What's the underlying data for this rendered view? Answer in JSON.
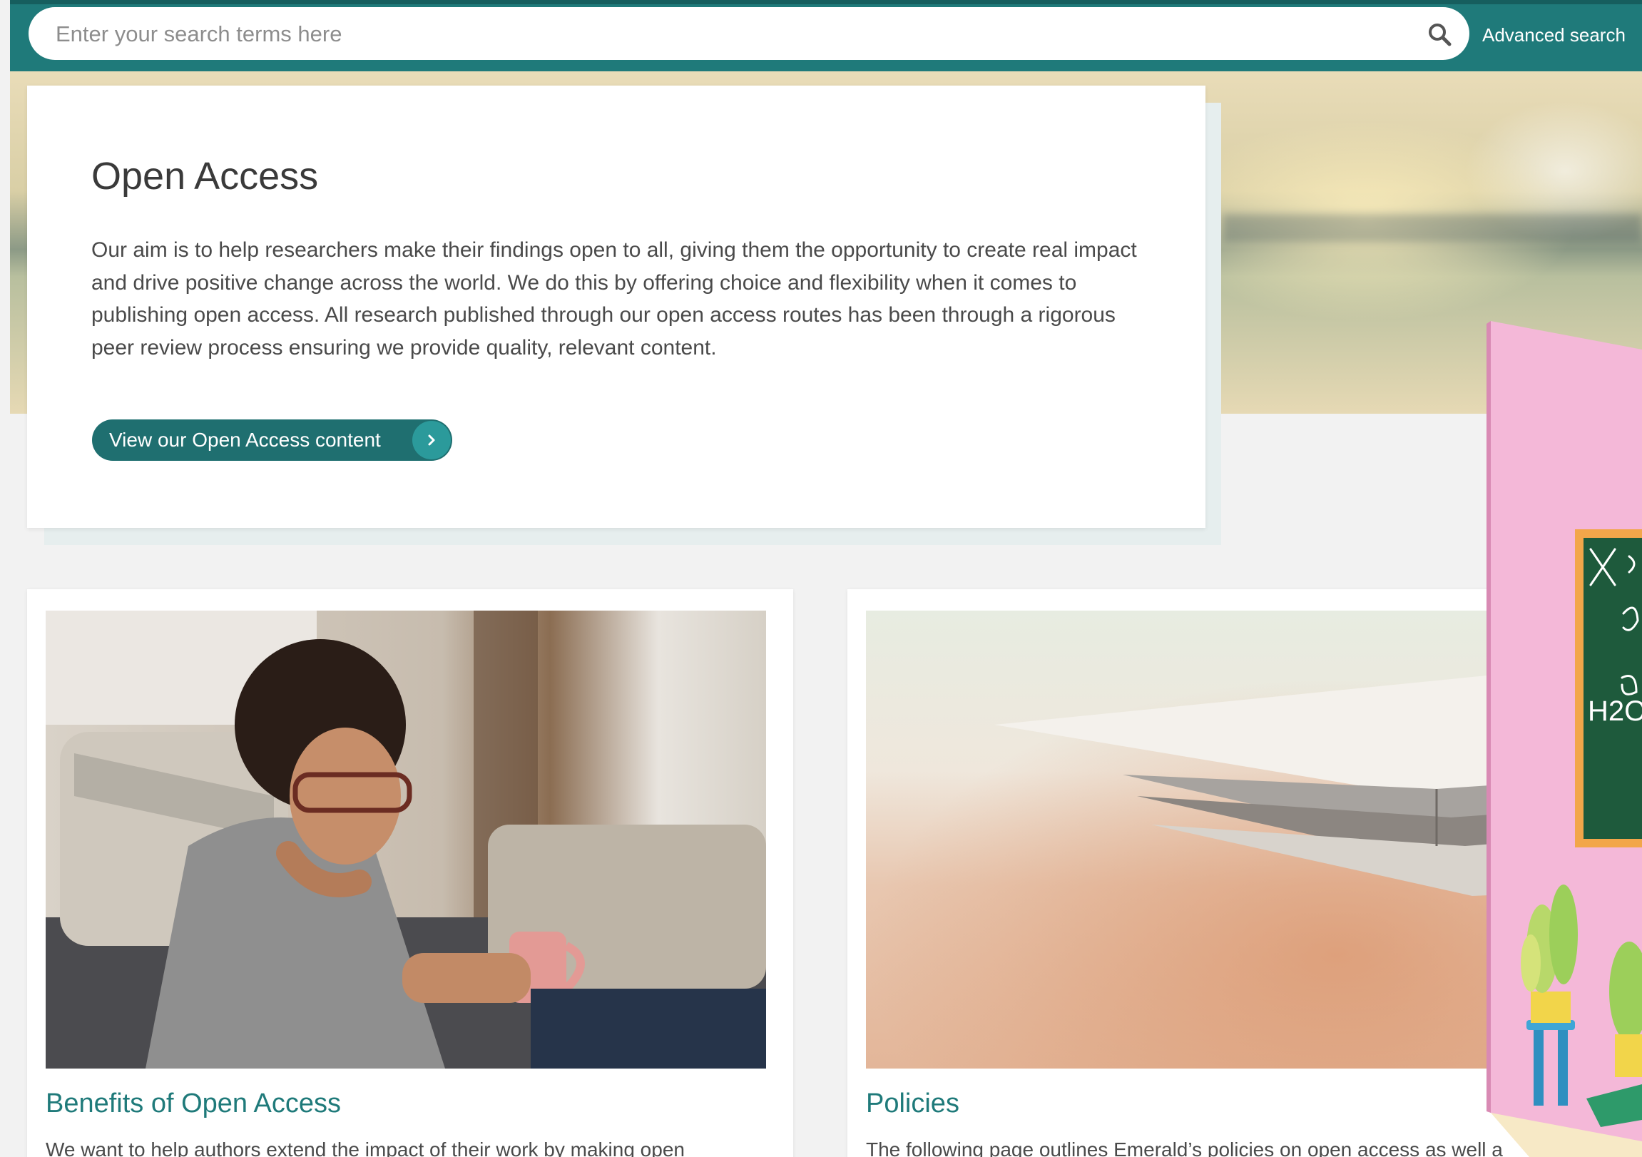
{
  "search": {
    "placeholder": "Enter your search terms here",
    "advanced_label": "Advanced search"
  },
  "hero": {
    "title": "Open Access",
    "body": "Our aim is to help researchers make their findings open to all, giving them the opportunity to create real impact and drive positive change across the world. We do this by offering choice and flexibility when it comes to publishing open access. All research published through our open access routes has been through a rigorous peer review process ensuring we provide quality, relevant content.",
    "cta_label": "View our Open Access content"
  },
  "cards": [
    {
      "title": "Benefits of Open Access",
      "text": "We want to help authors extend the impact of their work by making open"
    },
    {
      "title": "Policies",
      "text": "The following page outlines Emerald’s policies on open access as well a"
    }
  ],
  "illustration": {
    "chalk_text": "H2O"
  },
  "colors": {
    "brand_teal": "#1f7a7a",
    "button_teal": "#1f6f70",
    "arrow_teal": "#2b9a9b",
    "illustration_pink": "#f4b8d8",
    "chalkboard_green": "#1e5a3c"
  }
}
